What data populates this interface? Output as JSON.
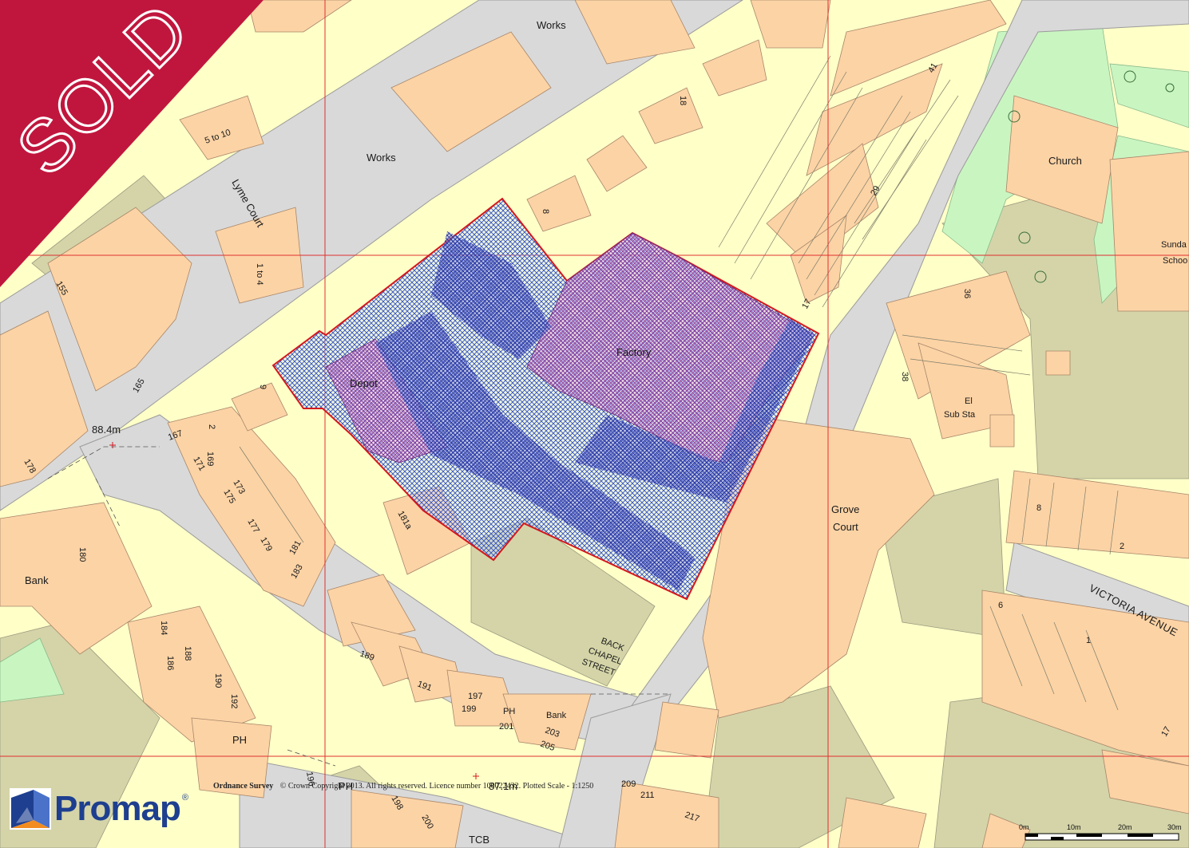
{
  "banner": {
    "text": "SOLD",
    "color": "#c0163d"
  },
  "labels": {
    "works_1": "Works",
    "works_2": "Works",
    "five_to_ten": "5 to 10",
    "lyme_court": "Lyme Court",
    "one_to_four": "1 to 4",
    "n155": "155",
    "n165": "165",
    "n178": "178",
    "spot_height_1": "88.4m",
    "n167": "167",
    "n2": "2",
    "n169": "169",
    "n171": "171",
    "n173": "173",
    "n175": "175",
    "n177": "177",
    "n179": "179",
    "n181": "181",
    "n183": "183",
    "n181a": "181a",
    "n9": "9",
    "n8": "8",
    "n18": "18",
    "depot": "Depot",
    "factory": "Factory",
    "n17": "17",
    "n29": "29",
    "n41": "41",
    "church": "Church",
    "sunday_school_1": "Sunda",
    "sunday_school_2": "Schoo",
    "n36": "36",
    "n38": "38",
    "el_sub_sta_1": "El",
    "el_sub_sta_2": "Sub Sta",
    "grove_court_1": "Grove",
    "grove_court_2": "Court",
    "n8b": "8",
    "n2b": "2",
    "victoria_avenue": "VICTORIA AVENUE",
    "n6": "6",
    "n1": "1",
    "n17b": "17",
    "bank_1": "Bank",
    "n180": "180",
    "n184": "184",
    "n186": "186",
    "n188": "188",
    "n190": "190",
    "n192": "192",
    "ph_1": "PH",
    "n189": "189",
    "n191": "191",
    "n197": "197",
    "n199": "199",
    "ph_2": "PH",
    "n201": "201",
    "bank_2": "Bank",
    "n203": "203",
    "n205": "205",
    "back_chapel_1": "BACK",
    "back_chapel_2": "CHAPEL",
    "back_chapel_3": "STREET",
    "n196": "196",
    "ph_3": "PH",
    "spot_height_2": "87.1m",
    "n209": "209",
    "n211": "211",
    "n217": "217",
    "n198": "198",
    "n200": "200",
    "tcb": "TCB"
  },
  "copyright": {
    "brand": "Ordnance Survey",
    "text": "© Crown Copyright 2013. All rights reserved. Licence number 100022432. Plotted Scale - 1:1250"
  },
  "scale_bar": {
    "ticks": [
      "0m",
      "10m",
      "20m",
      "30m"
    ]
  },
  "logo": {
    "word": "Promap",
    "registered": "®"
  },
  "colors": {
    "building": "#fcd3a5",
    "land": "#ffffc8",
    "road": "#d9d9d9",
    "grey_land": "#d4d4a8",
    "park": "#c9f5c1",
    "site_outline": "#d4181e",
    "hatch_blue": "#3b5bd6",
    "hatch_purple": "#b23bb0",
    "grid_line": "#e03030"
  }
}
